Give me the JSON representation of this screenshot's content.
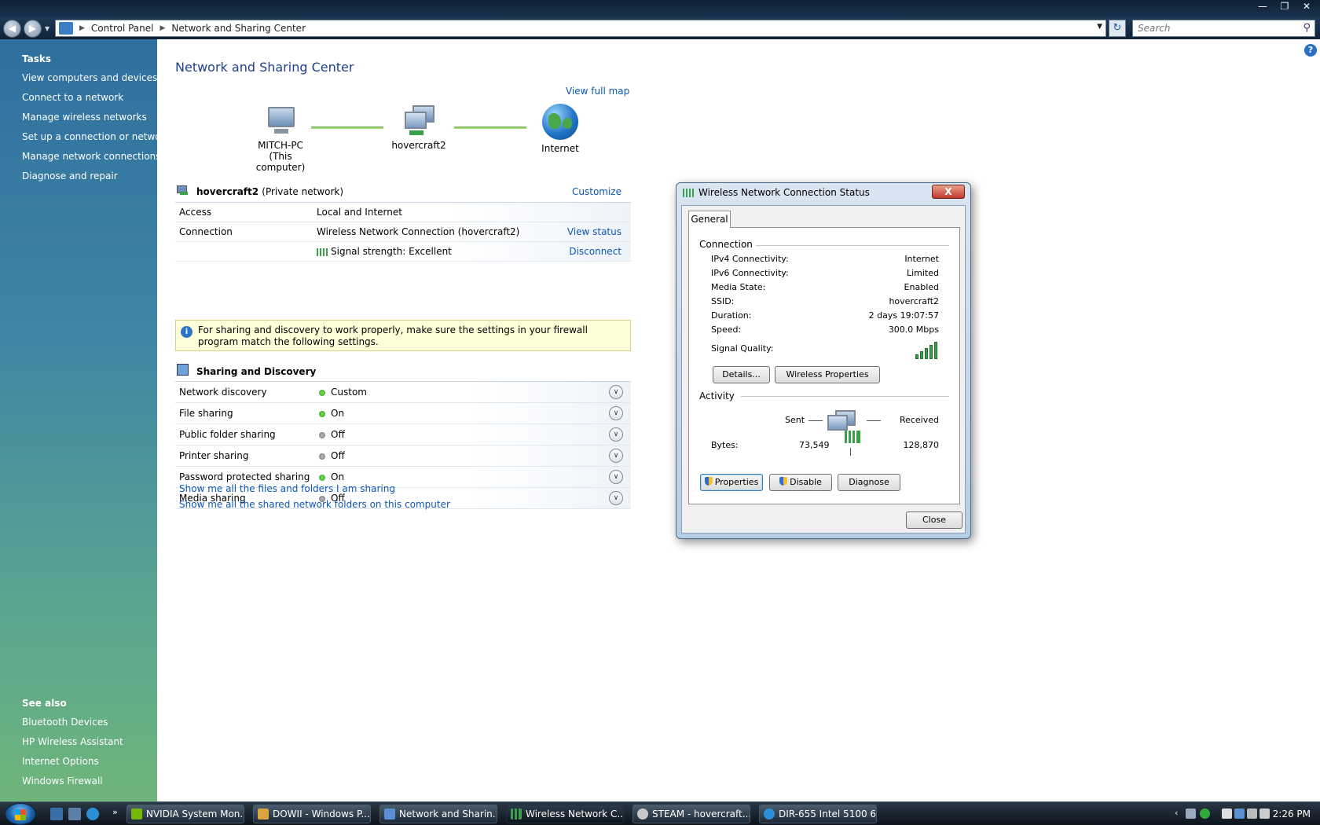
{
  "address": {
    "crumbs": [
      "Control Panel",
      "Network and Sharing Center"
    ],
    "search_placeholder": "Search"
  },
  "sidebar": {
    "tasks_heading": "Tasks",
    "tasks": [
      "View computers and devices",
      "Connect to a network",
      "Manage wireless networks",
      "Set up a connection or network",
      "Manage network connections",
      "Diagnose and repair"
    ],
    "see_also_heading": "See also",
    "see_also": [
      "Bluetooth Devices",
      "HP Wireless Assistant",
      "Internet Options",
      "Windows Firewall"
    ]
  },
  "main": {
    "title": "Network and Sharing Center",
    "view_full_map": "View full map",
    "map": {
      "computer_name": "MITCH-PC",
      "computer_sub": "(This computer)",
      "network_name": "hovercraft2",
      "internet": "Internet"
    },
    "network": {
      "name": "hovercraft2",
      "type": "(Private network)",
      "customize": "Customize",
      "access_label": "Access",
      "access_value": "Local and Internet",
      "connection_label": "Connection",
      "connection_value": "Wireless Network Connection (hovercraft2)",
      "view_status": "View status",
      "signal_text": "Signal strength:  Excellent",
      "disconnect": "Disconnect"
    },
    "firewall_notice": "For sharing and discovery to work properly, make sure the settings in your firewall program match the following settings.",
    "sharing": {
      "title": "Sharing and Discovery",
      "rows": [
        {
          "label": "Network discovery",
          "value": "Custom",
          "status": "on"
        },
        {
          "label": "File sharing",
          "value": "On",
          "status": "on"
        },
        {
          "label": "Public folder sharing",
          "value": "Off",
          "status": "off"
        },
        {
          "label": "Printer sharing",
          "value": "Off",
          "status": "off"
        },
        {
          "label": "Password protected sharing",
          "value": "On",
          "status": "on"
        },
        {
          "label": "Media sharing",
          "value": "Off",
          "status": "off"
        }
      ],
      "link_files": "Show me all the files and folders I am sharing",
      "link_folders": "Show me all the shared network folders on this computer"
    }
  },
  "dialog": {
    "title": "Wireless Network Connection Status",
    "close_x": "X",
    "tab": "General",
    "connection_group": "Connection",
    "fields": [
      {
        "label": "IPv4 Connectivity:",
        "value": "Internet"
      },
      {
        "label": "IPv6 Connectivity:",
        "value": "Limited"
      },
      {
        "label": "Media State:",
        "value": "Enabled"
      },
      {
        "label": "SSID:",
        "value": "hovercraft2"
      },
      {
        "label": "Duration:",
        "value": "2 days 19:07:57"
      },
      {
        "label": "Speed:",
        "value": "300.0 Mbps"
      }
    ],
    "signal_quality_label": "Signal Quality:",
    "signal_bars": 5,
    "details_btn": "Details...",
    "wireless_props_btn": "Wireless Properties",
    "activity_group": "Activity",
    "sent_label": "Sent",
    "received_label": "Received",
    "bytes_label": "Bytes:",
    "bytes_sent": "73,549",
    "bytes_received": "128,870",
    "properties_btn": "Properties",
    "disable_btn": "Disable",
    "diagnose_btn": "Diagnose",
    "close_btn": "Close"
  },
  "taskbar": {
    "tasks": [
      "NVIDIA System Mon...",
      "DOWII - Windows P...",
      "Network and Sharin...",
      "Wireless Network C...",
      "STEAM - hovercraft...",
      "DIR-655 Intel 5100 6..."
    ],
    "clock": "2:26 PM"
  },
  "colors": {
    "link": "#0c57b3",
    "title": "#1e3f8a",
    "sidebar_top": "#2f6f9f",
    "sidebar_bottom": "#6fb57a"
  }
}
